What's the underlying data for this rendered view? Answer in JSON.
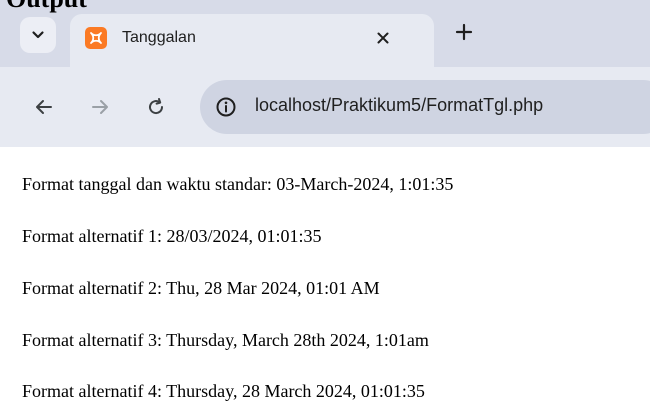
{
  "caption": "Output",
  "browser": {
    "tab": {
      "title": "Tanggalan",
      "favicon": "xampp-icon"
    },
    "url": "localhost/Praktikum5/FormatTgl.php",
    "colors": {
      "tabstrip": "#d7dbe8",
      "toolbar": "#e7eaf2",
      "omnibox": "#cfd4e2",
      "favicon": "#fb7a24"
    }
  },
  "page": {
    "lines": [
      "Format tanggal dan waktu standar: 03-March-2024, 1:01:35",
      "Format alternatif 1: 28/03/2024, 01:01:35",
      "Format alternatif 2: Thu, 28 Mar 2024, 01:01 AM",
      "Format alternatif 3: Thursday, March 28th 2024, 1:01am",
      "Format alternatif 4: Thursday, 28 March 2024, 01:01:35"
    ]
  }
}
